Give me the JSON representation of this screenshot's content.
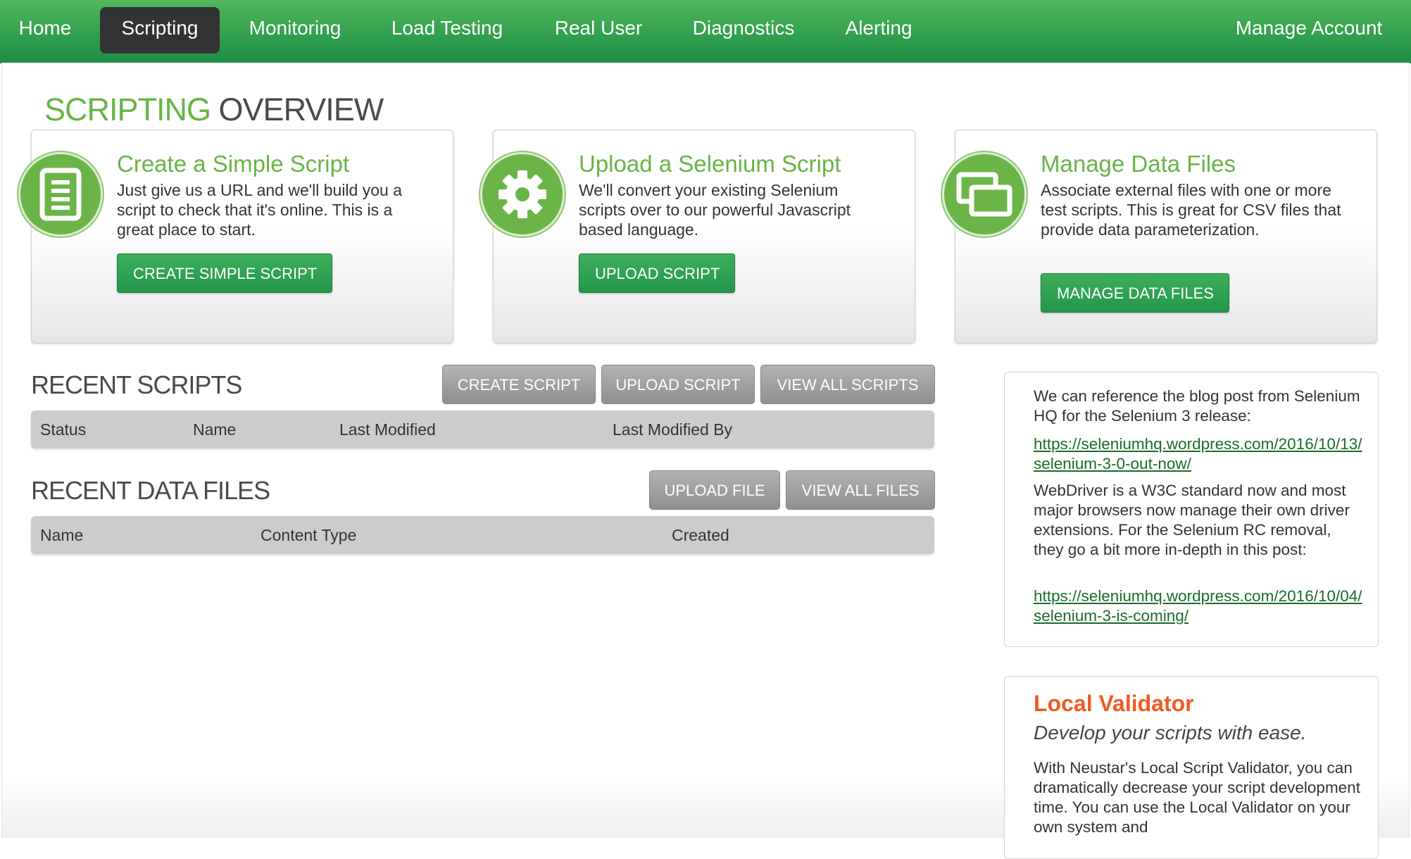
{
  "nav": {
    "items": [
      {
        "label": "Home"
      },
      {
        "label": "Scripting"
      },
      {
        "label": "Monitoring"
      },
      {
        "label": "Load Testing"
      },
      {
        "label": "Real User"
      },
      {
        "label": "Diagnostics"
      },
      {
        "label": "Alerting"
      }
    ],
    "account_label": "Manage Account",
    "active": "Scripting"
  },
  "page_title": {
    "accent": "SCRIPTING",
    "rest": " OVERVIEW"
  },
  "cards": [
    {
      "icon": "document-icon",
      "title": "Create a Simple Script",
      "description": "Just give us a URL and we'll build you a script to check that it's online. This is a great place to start.",
      "button": "CREATE SIMPLE SCRIPT"
    },
    {
      "icon": "gear-icon",
      "title": "Upload a Selenium Script",
      "description": "We'll convert your existing Selenium scripts over to our powerful Javascript based language.",
      "button": "UPLOAD SCRIPT"
    },
    {
      "icon": "windows-icon",
      "title": "Manage Data Files",
      "description": "Associate external files with one or more test scripts. This is great for CSV files that provide data parameterization.",
      "button": "MANAGE DATA FILES"
    }
  ],
  "recent_scripts": {
    "title": "RECENT SCRIPTS",
    "buttons": [
      "CREATE SCRIPT",
      "UPLOAD SCRIPT",
      "VIEW ALL SCRIPTS"
    ],
    "columns": [
      "Status",
      "Name",
      "Last Modified",
      "Last Modified By"
    ]
  },
  "recent_data_files": {
    "title": "RECENT DATA FILES",
    "buttons": [
      "UPLOAD FILE",
      "VIEW ALL FILES"
    ],
    "columns": [
      "Name",
      "Content Type",
      "Created"
    ]
  },
  "blog_box": {
    "intro": "We can reference the blog post from Selenium HQ for the Selenium 3 release:",
    "link1": "https://seleniumhq.wordpress.com/2016/10/13/selenium-3-0-out-now/",
    "body": "WebDriver is a W3C standard now and most major browsers now manage their own driver extensions. For the Selenium RC removal, they go a bit more in-depth in this post:",
    "link2": "https://seleniumhq.wordpress.com/2016/10/04/selenium-3-is-coming/"
  },
  "validator_box": {
    "title": "Local Validator",
    "subtitle": "Develop your scripts with ease.",
    "body": "With Neustar's Local Script Validator, you can dramatically decrease your script development time. You can use the Local Validator on your own system and",
    "title_color": "#f05a22"
  },
  "colors": {
    "brand_green": "#67b545",
    "nav_active": "#333333",
    "button_green": "#23964a",
    "button_gray": "#999999"
  }
}
